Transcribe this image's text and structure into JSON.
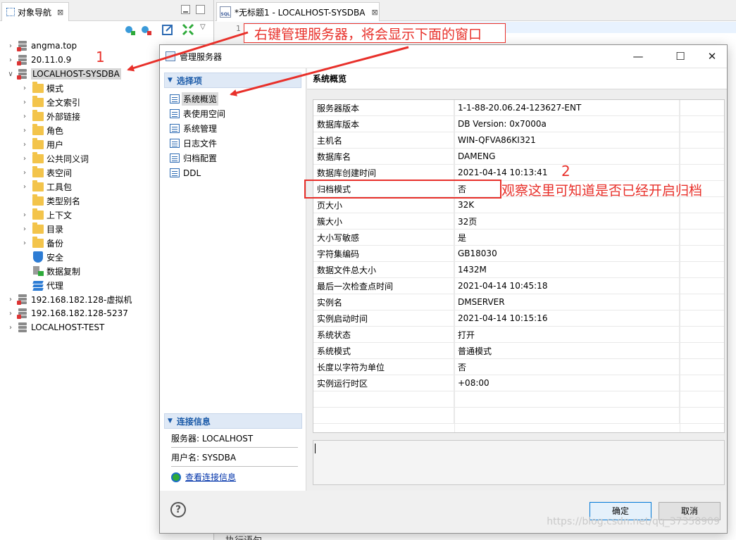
{
  "navigator": {
    "tab_title": "对象导航",
    "tab_close": "⊠",
    "tree": [
      {
        "label": "angma.top",
        "type": "db",
        "expanded": false
      },
      {
        "label": "20.11.0.9",
        "type": "db",
        "expanded": false
      },
      {
        "label": "LOCALHOST-SYSDBA",
        "type": "db",
        "expanded": true,
        "selected": true
      },
      {
        "label": "模式",
        "type": "folder"
      },
      {
        "label": "全文索引",
        "type": "folder"
      },
      {
        "label": "外部链接",
        "type": "folder"
      },
      {
        "label": "角色",
        "type": "folder"
      },
      {
        "label": "用户",
        "type": "folder"
      },
      {
        "label": "公共同义词",
        "type": "folder"
      },
      {
        "label": "表空间",
        "type": "folder"
      },
      {
        "label": "工具包",
        "type": "folder"
      },
      {
        "label": "类型别名",
        "type": "folder-noexpand"
      },
      {
        "label": "上下文",
        "type": "folder"
      },
      {
        "label": "目录",
        "type": "folder"
      },
      {
        "label": "备份",
        "type": "folder"
      },
      {
        "label": "安全",
        "type": "shield"
      },
      {
        "label": "数据复制",
        "type": "repl"
      },
      {
        "label": "代理",
        "type": "stack"
      },
      {
        "label": "192.168.182.128-虚拟机",
        "type": "db",
        "expanded": false
      },
      {
        "label": "192.168.182.128-5237",
        "type": "db",
        "expanded": false
      },
      {
        "label": "LOCALHOST-TEST",
        "type": "db-plain",
        "expanded": false
      }
    ]
  },
  "editor": {
    "tab_title": "*无标题1 - LOCALHOST-SYSDBA",
    "tab_close": "⊠",
    "line_number": "1",
    "sql_icon": "SQL",
    "bottom_fragment": "执行语句"
  },
  "annotations": {
    "step1_text": "右键管理服务器，将会显示下面的窗口",
    "num1": "1",
    "num2": "2",
    "step2_text": "观察这里可知道是否已经开启归档",
    "color": "#e8302a"
  },
  "dialog": {
    "title": "管理服务器",
    "minimize": "—",
    "maximize": "☐",
    "close": "✕",
    "options_header": "选择项",
    "options": [
      "系统概览",
      "表使用空间",
      "系统管理",
      "日志文件",
      "归档配置",
      "DDL"
    ],
    "selected_option": 0,
    "content_header": "系统概览",
    "properties": [
      {
        "name": "服务器版本",
        "value": "1-1-88-20.06.24-123627-ENT"
      },
      {
        "name": "数据库版本",
        "value": "DB Version: 0x7000a"
      },
      {
        "name": "主机名",
        "value": "WIN-QFVA86KI321"
      },
      {
        "name": "数据库名",
        "value": "DAMENG"
      },
      {
        "name": "数据库创建时间",
        "value": "2021-04-14 10:13:41"
      },
      {
        "name": "归档模式",
        "value": "否"
      },
      {
        "name": "页大小",
        "value": "32K"
      },
      {
        "name": "簇大小",
        "value": "32页"
      },
      {
        "name": "大小写敏感",
        "value": "是"
      },
      {
        "name": "字符集编码",
        "value": "GB18030"
      },
      {
        "name": "数据文件总大小",
        "value": "1432M"
      },
      {
        "name": "最后一次检查点时间",
        "value": "2021-04-14 10:45:18"
      },
      {
        "name": "实例名",
        "value": "DMSERVER"
      },
      {
        "name": "实例启动时间",
        "value": "2021-04-14 10:15:16"
      },
      {
        "name": "系统状态",
        "value": "打开"
      },
      {
        "name": "系统模式",
        "value": "普通模式"
      },
      {
        "name": "长度以字符为单位",
        "value": "否"
      },
      {
        "name": "实例运行时区",
        "value": "+08:00"
      }
    ],
    "connection_header": "连接信息",
    "server_label": "服务器: LOCALHOST",
    "user_label": "用户名: SYSDBA",
    "view_conn_link": "查看连接信息",
    "help": "?",
    "ok_label": "确定",
    "cancel_label": "取消"
  },
  "watermark": "https://blog.csdn.net/qq_37358909",
  "colors": {
    "accent_blue": "#1a5aa8",
    "section_header_bg": "#dfe9f6",
    "folder": "#f3c44b"
  }
}
